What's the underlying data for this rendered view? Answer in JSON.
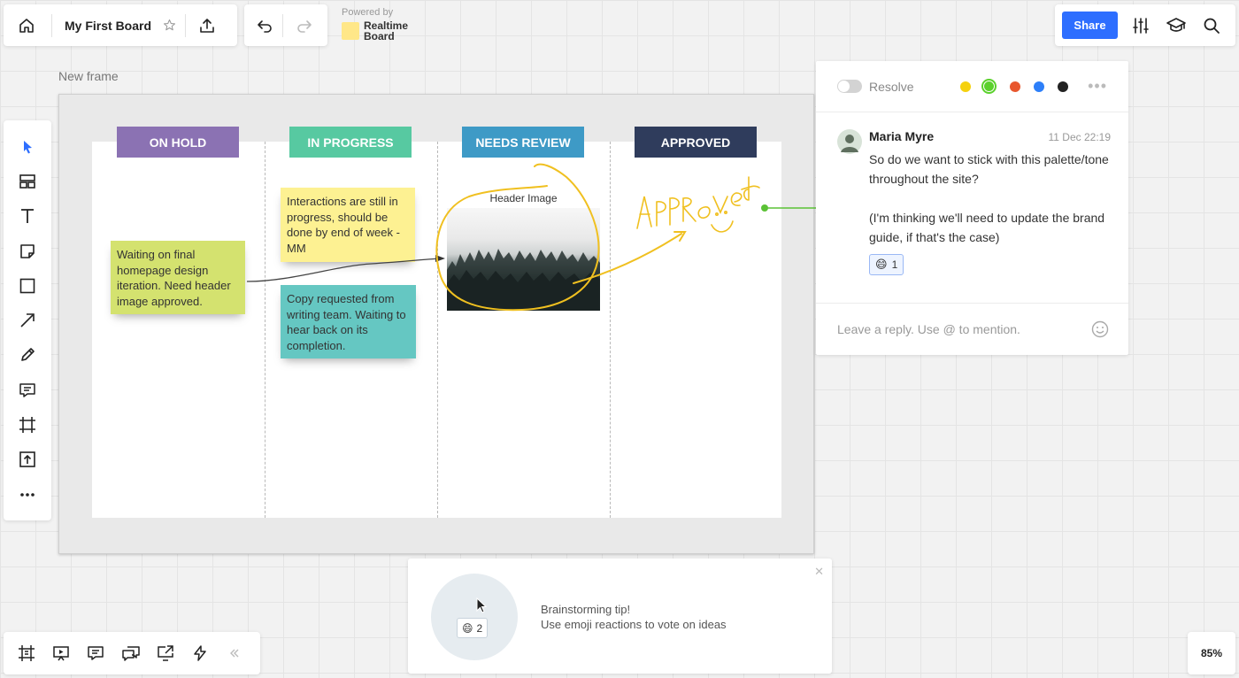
{
  "topbar": {
    "board_title": "My First Board",
    "powered_by": "Powered by",
    "brand": "Realtime Board",
    "share_label": "Share"
  },
  "frame": {
    "label": "New frame"
  },
  "columns": [
    {
      "label": "ON HOLD",
      "color": "#8b72b3"
    },
    {
      "label": "IN PROGRESS",
      "color": "#57c9a1"
    },
    {
      "label": "NEEDS REVIEW",
      "color": "#3e9ac6"
    },
    {
      "label": "APPROVED",
      "color": "#2f3c5c"
    }
  ],
  "stickies": [
    {
      "text": "Waiting on final homepage design iteration. Need header image approved.",
      "color": "#d4e26f"
    },
    {
      "text": "Interactions are still in progress, should be done by end of week - MM",
      "color": "#fdf192"
    },
    {
      "text": "Copy requested from writing team. Waiting to hear back on its completion.",
      "color": "#65c7c2"
    }
  ],
  "image_card": {
    "label": "Header Image"
  },
  "annotation": {
    "text": "Approved",
    "color": "#f0c020",
    "connector_color": "#5bc236"
  },
  "comment": {
    "resolve_label": "Resolve",
    "colors": [
      "#f5d10f",
      "#5bd12c",
      "#e8572e",
      "#2d7ff9",
      "#222222"
    ],
    "author": "Maria Myre",
    "date": "11 Dec 22:19",
    "text_1": "So do we want to stick with this palette/tone throughout the site?",
    "text_2": "(I'm thinking we'll need to update the brand guide, if that's the case)",
    "reaction_count": "1",
    "reply_placeholder": "Leave a reply. Use @ to mention."
  },
  "tip": {
    "title": "Brainstorming tip!",
    "text": "Use emoji reactions to vote on ideas",
    "reaction_count": "2"
  },
  "zoom": "85%",
  "icons": {
    "left_tools": [
      "select-arrow-icon",
      "templates-icon",
      "text-icon",
      "sticky-note-icon",
      "shape-icon",
      "connection-line-icon",
      "pen-icon",
      "comment-icon",
      "frame-icon",
      "upload-icon",
      "more-icon"
    ],
    "bottom_tools": [
      "frames-list-icon",
      "presentation-icon",
      "comments-list-icon",
      "chat-icon",
      "screen-share-icon",
      "activity-icon",
      "collapse-icon"
    ]
  }
}
